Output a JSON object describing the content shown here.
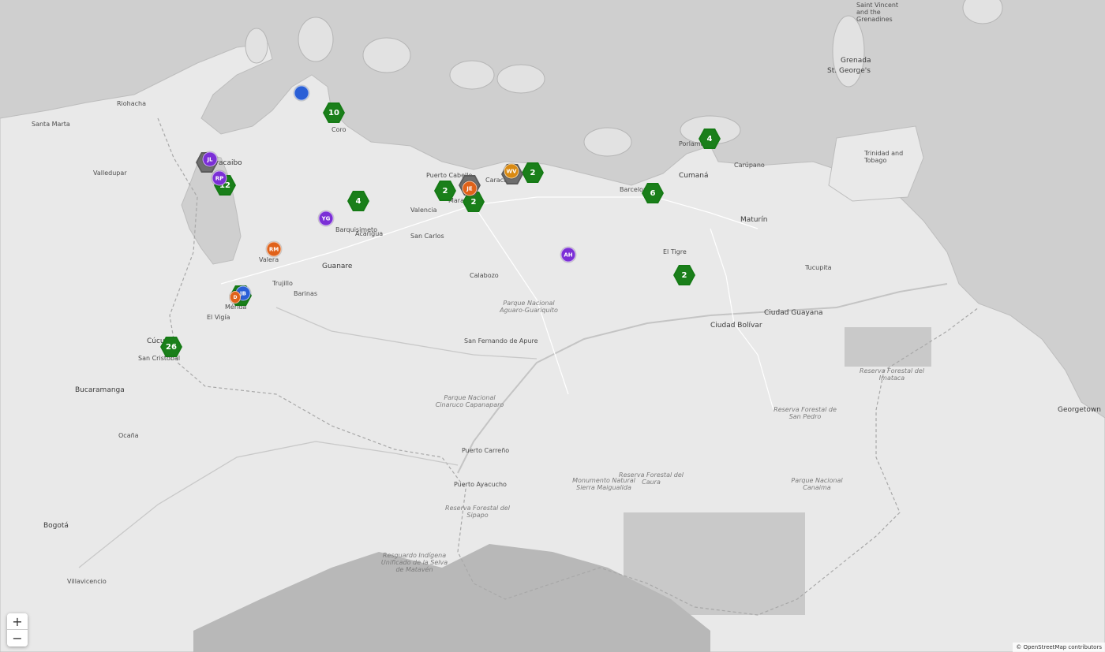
{
  "map": {
    "attribution": "© OpenStreetMap contributors",
    "zoom_in_label": "+",
    "zoom_out_label": "−",
    "colors": {
      "cluster": "#1a7f1a",
      "sea": "#cfcfcf",
      "land": "#e9e9e9",
      "purple": "#7b2fd6",
      "orange": "#e0621a",
      "blue": "#2a5fd6",
      "amber": "#d98a12"
    },
    "clusters": [
      {
        "count": "10"
      },
      {
        "count": "4"
      },
      {
        "count": "4"
      },
      {
        "count": "2"
      },
      {
        "count": "2"
      },
      {
        "count": "2"
      },
      {
        "count": "6"
      },
      {
        "count": "2"
      },
      {
        "count": "12"
      },
      {
        "count": "26"
      },
      {
        "count": ""
      }
    ],
    "people": [
      {
        "initials": "JL"
      },
      {
        "initials": "RP"
      },
      {
        "initials": "YG"
      },
      {
        "initials": "RM"
      },
      {
        "initials": "JB"
      },
      {
        "initials": "D"
      },
      {
        "initials": "JE"
      },
      {
        "initials": "WV"
      },
      {
        "initials": "AH"
      },
      {
        "initials": ""
      }
    ],
    "place_labels": {
      "cities": [
        "Santa Marta",
        "Riohacha",
        "Valledupar",
        "Maracaibo",
        "Cúcuta",
        "Bucaramanga",
        "Bogotá",
        "Villavicencio",
        "Barquisimeto",
        "Valencia",
        "Maracay",
        "Caracas",
        "Barcelona",
        "Cumaná",
        "Maturín",
        "Ciudad Bolívar",
        "Ciudad Guayana",
        "Puerto Ayacucho",
        "Georgetown",
        "Grenada",
        "St. George's",
        "Trinidad and Tobago",
        "Guanare",
        "Barinas",
        "Mérida",
        "San Cristóbal",
        "Coro",
        "Puerto Cabello",
        "San Fernando de Apure",
        "Tucupita",
        "El Tigre",
        "Calabozo",
        "Acarigua",
        "San Carlos",
        "Valera",
        "Trujillo",
        "El Vigía",
        "Carúpano",
        "Porlamar",
        "Puerto Carreño",
        "Saint Vincent and the Grenadines",
        "Ocaña"
      ],
      "reserves": [
        "Reserva Forestal del Caura",
        "Reserva Forestal del Sipapo",
        "Parque Nacional Canaima",
        "Reserva Forestal del Imataca",
        "Parque Nacional Cinaruco Capanaparo",
        "Parque Nacional Aguaro-Guariquito",
        "Resguardo Indígena Unificado de la Selva de Matavén",
        "Monumento Natural Sierra Maigualida",
        "Reserva Forestal de San Pedro"
      ]
    }
  }
}
